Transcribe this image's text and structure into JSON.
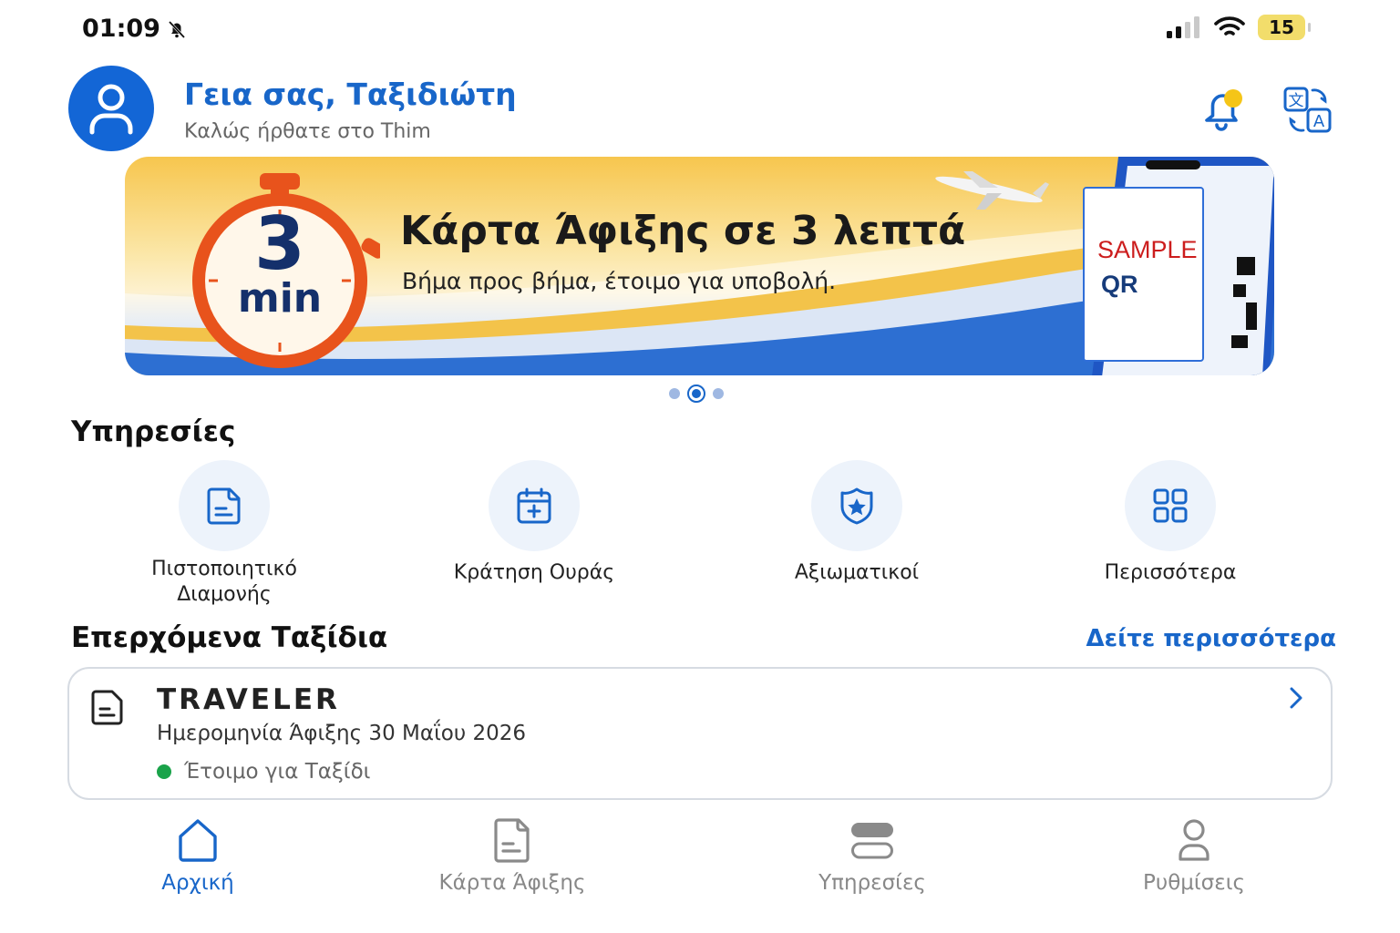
{
  "status_bar": {
    "time": "01:09",
    "battery": "15"
  },
  "header": {
    "greeting": "Γεια σας, Ταξιδιώτη",
    "welcome": "Καλώς ήρθατε στο Thim"
  },
  "banner": {
    "title": "Κάρτα Άφιξης σε 3 λεπτά",
    "subtitle": "Βήμα προς βήμα, έτοιμο για υποβολή.",
    "timer_number": "3",
    "timer_unit": "min",
    "sample_text": "SAMPLE",
    "sample_qr": "QR"
  },
  "carousel": {
    "count": 3,
    "active_index": 1
  },
  "services": {
    "title": "Υπηρεσίες",
    "items": [
      {
        "label": "Πιστοποιητικό\nΔιαμονής",
        "icon": "document-icon"
      },
      {
        "label": "Κράτηση Ουράς",
        "icon": "calendar-add-icon"
      },
      {
        "label": "Αξιωματικοί",
        "icon": "police-badge-icon"
      },
      {
        "label": "Περισσότερα",
        "icon": "grid-icon"
      }
    ]
  },
  "trips": {
    "title": "Επερχόμενα Ταξίδια",
    "see_more": "Δείτε περισσότερα",
    "item": {
      "name": "TRAVELER",
      "date": "Ημερομηνία Άφιξης 30 Μαΐου 2026",
      "status": "Έτοιμο για Ταξίδι",
      "status_color": "#1aa34a"
    }
  },
  "nav": {
    "items": [
      {
        "label": "Αρχική",
        "icon": "home-icon",
        "active": true
      },
      {
        "label": "Κάρτα Άφιξης",
        "icon": "document-icon",
        "active": false
      },
      {
        "label": "Υπηρεσίες",
        "icon": "layers-icon",
        "active": false
      },
      {
        "label": "Ρυθμίσεις",
        "icon": "person-icon",
        "active": false
      }
    ]
  },
  "colors": {
    "accent": "#1866c9",
    "avatar": "#1366d6",
    "notification": "#f5c518"
  }
}
